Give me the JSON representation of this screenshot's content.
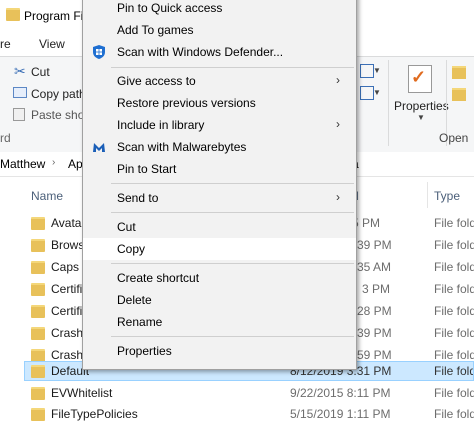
{
  "window": {
    "title": "Program Fi",
    "tabs": {
      "share": "re",
      "view": "View"
    }
  },
  "ribbon": {
    "cut": "Cut",
    "copy_path": "Copy path",
    "paste_shortcut": "Paste sho",
    "clipboard_group": "rd",
    "properties": "Properties",
    "open_group": "Open"
  },
  "address": {
    "crumb1": "Matthew",
    "crumb2": "Ap",
    "crumb_tail": "a"
  },
  "columns": {
    "name": "Name",
    "date": "d",
    "type": "Type"
  },
  "files": [
    {
      "name": "Avatar",
      "date": "5 PM",
      "type": "File fold"
    },
    {
      "name": "Brows",
      "date": "39 PM",
      "type": "File fold"
    },
    {
      "name": "Caps",
      "date": "35 AM",
      "type": "File fold"
    },
    {
      "name": "Certifi",
      "date": "3 PM",
      "type": "File fold"
    },
    {
      "name": "Certifi",
      "date": "28 PM",
      "type": "File fold"
    },
    {
      "name": "Crash",
      "date": "39 PM",
      "type": "File fold"
    },
    {
      "name": "Crashp",
      "date": "59 PM",
      "type": "File fold"
    },
    {
      "name": "Default",
      "date": "8/12/2019 3:31 PM",
      "type": "File fold"
    },
    {
      "name": "EVWhitelist",
      "date": "9/22/2015 8:11 PM",
      "type": "File fold"
    },
    {
      "name": "FileTypePolicies",
      "date": "5/15/2019 1:11 PM",
      "type": "File fold"
    }
  ],
  "context_menu": {
    "items": [
      {
        "label": "Pin to Quick access"
      },
      {
        "label": "Add To games"
      },
      {
        "label": "Scan with Windows Defender..."
      },
      {
        "label": "Give access to"
      },
      {
        "label": "Restore previous versions"
      },
      {
        "label": "Include in library"
      },
      {
        "label": "Scan with Malwarebytes"
      },
      {
        "label": "Pin to Start"
      },
      {
        "label": "Send to"
      },
      {
        "label": "Cut"
      },
      {
        "label": "Copy"
      },
      {
        "label": "Create shortcut"
      },
      {
        "label": "Delete"
      },
      {
        "label": "Rename"
      },
      {
        "label": "Properties"
      }
    ],
    "submenu_arrow": "›",
    "hover_item": "Copy"
  },
  "icons": {
    "defender": "windows-defender-icon",
    "malwarebytes": "malwarebytes-icon",
    "folder": "folder-icon"
  },
  "colors": {
    "selection": "#cce8ff",
    "folder": "#e8c15a",
    "menu_bg": "#f2f2f2"
  }
}
